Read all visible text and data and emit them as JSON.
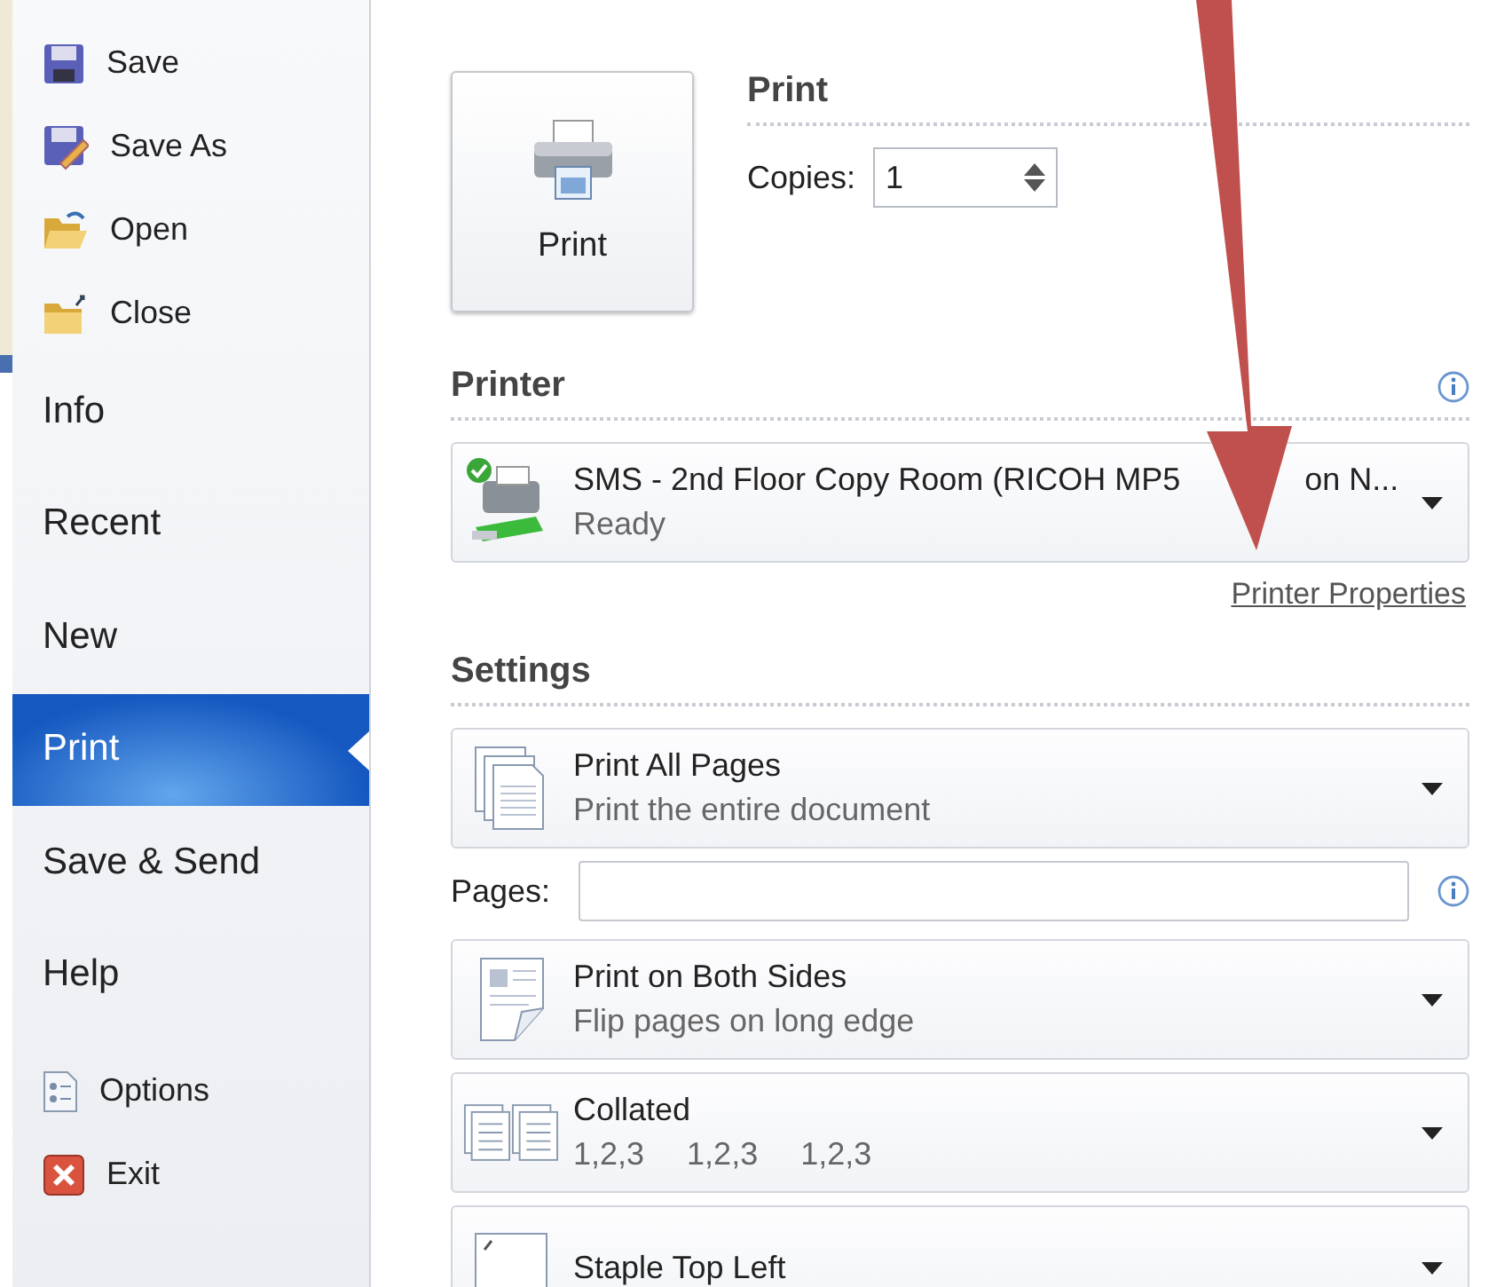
{
  "menu": {
    "items": [
      {
        "label": "Save",
        "kind": "command"
      },
      {
        "label": "Save As",
        "kind": "command"
      },
      {
        "label": "Open",
        "kind": "command"
      },
      {
        "label": "Close",
        "kind": "command"
      },
      {
        "label": "Info",
        "kind": "section",
        "selected": false
      },
      {
        "label": "Recent",
        "kind": "section",
        "selected": false
      },
      {
        "label": "New",
        "kind": "section",
        "selected": false
      },
      {
        "label": "Print",
        "kind": "section",
        "selected": true
      },
      {
        "label": "Save & Send",
        "kind": "section",
        "selected": false
      },
      {
        "label": "Help",
        "kind": "section",
        "selected": false
      },
      {
        "label": "Options",
        "kind": "command"
      },
      {
        "label": "Exit",
        "kind": "command"
      }
    ]
  },
  "print": {
    "button": "Print",
    "heading": "Print",
    "copies_label": "Copies:",
    "copies_value": "1"
  },
  "printer": {
    "heading": "Printer",
    "name": "SMS - 2nd Floor Copy Room (RICOH MP5",
    "name_end": "on N...",
    "status": "Ready",
    "properties_link": "Printer Properties"
  },
  "settings": {
    "heading": "Settings",
    "pages_label": "Pages:",
    "options": [
      {
        "kind": "pages",
        "title": "Print All Pages",
        "subtitle": "Print the entire document"
      },
      {
        "kind": "sides",
        "title": "Print on Both Sides",
        "subtitle": "Flip pages on long edge"
      },
      {
        "kind": "collate",
        "title": "Collated",
        "parts": [
          "1,2,3",
          "1,2,3",
          "1,2,3"
        ]
      },
      {
        "kind": "staple",
        "title": "Staple Top Left"
      }
    ]
  }
}
